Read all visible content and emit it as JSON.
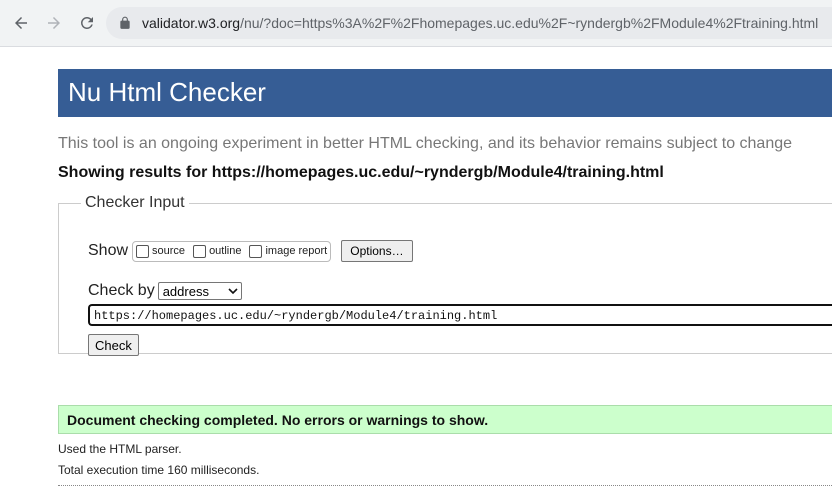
{
  "browser": {
    "url_host": "validator.w3.org",
    "url_path": "/nu/?doc=https%3A%2F%2Fhomepages.uc.edu%2F~ryndergb%2FModule4%2Ftraining.html"
  },
  "header": {
    "title": "Nu Html Checker"
  },
  "tagline": "This tool is an ongoing experiment in better HTML checking, and its behavior remains subject to change",
  "results": {
    "prefix": "Showing results for ",
    "url": "https://homepages.uc.edu/~ryndergb/Module4/training.html"
  },
  "checker_input": {
    "legend": "Checker Input",
    "show_label": "Show",
    "options": [
      {
        "label": "source",
        "checked": false
      },
      {
        "label": "outline",
        "checked": false
      },
      {
        "label": "image report",
        "checked": false
      }
    ],
    "options_button": "Options…",
    "check_by_label": "Check by",
    "check_by_value": "address",
    "document_url": "https://homepages.uc.edu/~ryndergb/Module4/training.html",
    "check_button": "Check"
  },
  "status": {
    "message": "Document checking completed. No errors or warnings to show.",
    "parser": "Used the HTML parser.",
    "timing": "Total execution time 160 milliseconds."
  },
  "colors": {
    "header_bg": "#365d95",
    "success_bg": "#ccffcc"
  }
}
